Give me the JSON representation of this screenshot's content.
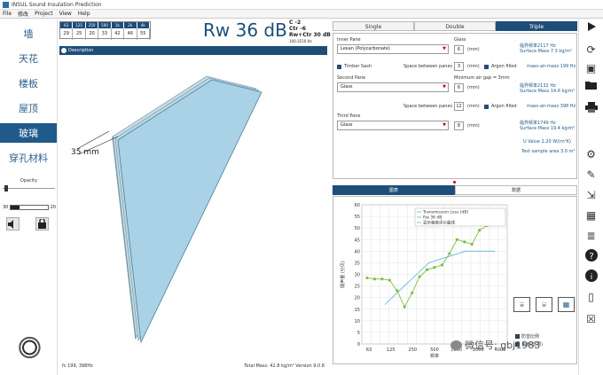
{
  "window": {
    "title": "INSUL Sound Insulation Prediction"
  },
  "menu": [
    "File",
    "修改",
    "Project",
    "View",
    "Help"
  ],
  "nav": [
    "墙",
    "天花",
    "楼板",
    "屋顶",
    "玻璃",
    "穿孔材料"
  ],
  "opacity": {
    "label": "Opacity",
    "min": "30",
    "max": "20",
    "fill_fraction": 0.24
  },
  "freq": {
    "headers": [
      "63",
      "125",
      "250",
      "500",
      "1k",
      "2k",
      "4k"
    ],
    "values": [
      "29",
      "25",
      "20",
      "33",
      "42",
      "46",
      "55"
    ]
  },
  "rating": {
    "rw": "Rw 36 dB",
    "c": "C -2",
    "ctr": "Ctr -6",
    "rwctr": "Rw+Ctr 30 dB",
    "range": "100-3150 Hz"
  },
  "desc": {
    "title": "Description"
  },
  "view": {
    "dimension": "35 mm"
  },
  "status": {
    "left": "fc 199, 398Hz",
    "right": "Total Mass: 42.8 kg/m²  Version 9.0.8"
  },
  "pane_tabs": [
    "Single",
    "Double",
    "Triple"
  ],
  "panel": {
    "inner_pane_label": "Inner Pane",
    "inner_pane_value": "Lexan (Polycarbonate)",
    "glass1_label": "Glass",
    "glass1_value": "6",
    "mm": "(mm)",
    "info1": [
      "临界频率2117 Hz",
      "Surface Mass 7.3 kg/m²"
    ],
    "timber_sash": "Timber Sash",
    "space_between": "Space between panes",
    "space1_value": "3",
    "argon": "Argon filled",
    "mam1": "mass-air-mass 199 Hz",
    "second_pane_label": "Second Pane",
    "min_gap": "Minimum air gap = 3mm",
    "second_pane_value": "Glass",
    "glass2_value": "6",
    "info2": [
      "临界频率2132 Hz",
      "Surface Mass 14.6 kg/m²"
    ],
    "space2_value": "12",
    "mam2": "mass-air-mass 398 Hz",
    "third_pane_label": "Third Pane",
    "third_pane_value": "Glass",
    "glass3_value": "8",
    "info3": [
      "临界频率1749 Hz",
      "Surface Mass 19.4 kg/m²"
    ],
    "uvalue": "U Value 2.20 W/(m²K)",
    "test_area": "Test sample area 3.0 m²"
  },
  "chart_tabs": [
    "图表",
    "数据"
  ],
  "chart_data": {
    "type": "line",
    "ylabel": "隔声量 (分贝)",
    "xlabel": "频率",
    "ylim": [
      0,
      60
    ],
    "yticks": [
      "0",
      "5",
      "10",
      "15",
      "20",
      "25",
      "30",
      "35",
      "40",
      "45",
      "50",
      "55",
      "60"
    ],
    "xticks": [
      "63",
      "125",
      "250",
      "500",
      "1000",
      "2000",
      "4000"
    ],
    "legend": [
      "Transmission Loss (dB)",
      "Rw 36 dB",
      "显示偏离评价曲线"
    ],
    "series": [
      {
        "name": "Transmission Loss (dB)",
        "values": [
          28.5,
          28,
          28,
          27.5,
          23,
          16,
          22,
          29,
          32,
          33,
          34,
          39,
          45,
          44,
          43,
          49,
          51,
          52,
          55
        ]
      }
    ],
    "rw_curve": [
      17,
      20,
      23,
      26,
      29,
      32,
      35,
      36,
      37,
      38,
      39,
      40,
      40,
      40,
      40,
      40
    ]
  },
  "chart_buttons": [
    "compare-1",
    "compare-2",
    "export"
  ],
  "chart_checks": [
    "防音比例",
    "更多(选项)"
  ],
  "watermark": "微信号: gbj1983"
}
